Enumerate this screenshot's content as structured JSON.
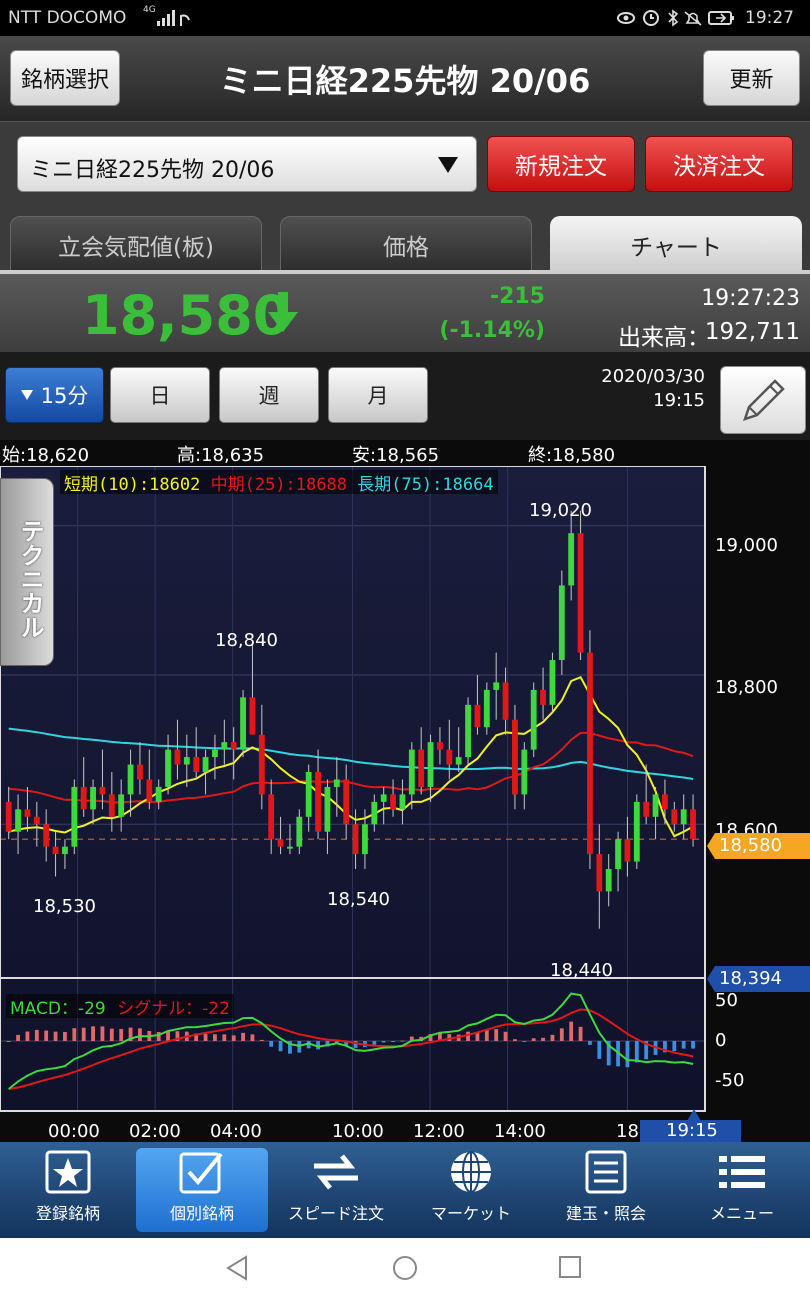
{
  "status": {
    "carrier": "NTT DOCOMO",
    "net": "4G",
    "time": "19:27"
  },
  "header": {
    "left_button": "銘柄選択",
    "title": "ミニ日経225先物 20/06",
    "right_button": "更新"
  },
  "toolbar": {
    "symbol_select": "ミニ日経225先物 20/06",
    "new_order": "新規注文",
    "close_order": "決済注文"
  },
  "tabs": [
    {
      "label": "立会気配値(板)"
    },
    {
      "label": "価格"
    },
    {
      "label": "チャート"
    }
  ],
  "price": {
    "last": "18,580",
    "change": "-215",
    "change_pct": "(-1.14%)",
    "time": "19:27:23",
    "volume_label": "出来高：",
    "volume": "192,711"
  },
  "period": {
    "active": "15分",
    "day": "日",
    "week": "週",
    "month": "月",
    "date": "2020/03/30",
    "time": "19:15"
  },
  "ohlc": {
    "open": "始:18,620",
    "high": "高:18,635",
    "low": "安:18,565",
    "close": "終:18,580"
  },
  "technical_label": "テクニカル",
  "ma": {
    "short": "短期(10):18602",
    "mid": "中期(25):18688",
    "long": "長期(75):18664"
  },
  "price_labels": {
    "l1": "19,020",
    "l2": "18,840",
    "l3": "18,530",
    "l4": "18,540",
    "l5": "18,440"
  },
  "y_ticks": [
    "19,000",
    "18,800",
    "18,600"
  ],
  "current_tag": "18,580",
  "low_tag": "18,394",
  "macd": {
    "macd": "MACD：-29",
    "signal": "シグナル：-22",
    "ticks": [
      "50",
      "0",
      "-50"
    ]
  },
  "x_ticks": [
    "00:00",
    "02:00",
    "04:00",
    "10:00",
    "12:00",
    "14:00",
    "18:"
  ],
  "x_current": "19:15",
  "nav": [
    {
      "label": "登録銘柄"
    },
    {
      "label": "個別銘柄"
    },
    {
      "label": "スピード注文"
    },
    {
      "label": "マーケット"
    },
    {
      "label": "建玉・照会"
    },
    {
      "label": "メニュー"
    }
  ],
  "colors": {
    "up": "#3fd93f",
    "down": "#e01818",
    "short_ma": "#f3f31c",
    "mid_ma": "#e01818",
    "long_ma": "#2fd6e0",
    "accent_orange": "#f5a623",
    "price_green": "#3bbf3b"
  },
  "chart_data": {
    "type": "candlestick",
    "y_range": [
      18394,
      19080
    ],
    "candles": [
      [
        18630,
        18650,
        18580,
        18590
      ],
      [
        18590,
        18640,
        18560,
        18620
      ],
      [
        18620,
        18650,
        18590,
        18610
      ],
      [
        18610,
        18630,
        18570,
        18600
      ],
      [
        18600,
        18620,
        18550,
        18570
      ],
      [
        18570,
        18590,
        18530,
        18560
      ],
      [
        18560,
        18580,
        18540,
        18570
      ],
      [
        18570,
        18660,
        18560,
        18650
      ],
      [
        18650,
        18690,
        18610,
        18620
      ],
      [
        18620,
        18660,
        18600,
        18650
      ],
      [
        18650,
        18700,
        18620,
        18640
      ],
      [
        18640,
        18670,
        18590,
        18610
      ],
      [
        18610,
        18660,
        18590,
        18640
      ],
      [
        18640,
        18700,
        18610,
        18680
      ],
      [
        18680,
        18710,
        18640,
        18660
      ],
      [
        18660,
        18700,
        18620,
        18630
      ],
      [
        18630,
        18660,
        18620,
        18650
      ],
      [
        18650,
        18720,
        18640,
        18700
      ],
      [
        18700,
        18740,
        18660,
        18680
      ],
      [
        18680,
        18720,
        18650,
        18690
      ],
      [
        18690,
        18730,
        18660,
        18670
      ],
      [
        18670,
        18700,
        18640,
        18690
      ],
      [
        18690,
        18720,
        18660,
        18700
      ],
      [
        18700,
        18740,
        18680,
        18710
      ],
      [
        18710,
        18730,
        18660,
        18700
      ],
      [
        18700,
        18780,
        18690,
        18770
      ],
      [
        18770,
        18840,
        18760,
        18720
      ],
      [
        18720,
        18760,
        18620,
        18640
      ],
      [
        18640,
        18660,
        18560,
        18580
      ],
      [
        18580,
        18610,
        18560,
        18570
      ],
      [
        18570,
        18600,
        18560,
        18570
      ],
      [
        18570,
        18620,
        18560,
        18610
      ],
      [
        18610,
        18680,
        18590,
        18670
      ],
      [
        18670,
        18700,
        18580,
        18590
      ],
      [
        18590,
        18660,
        18560,
        18650
      ],
      [
        18650,
        18690,
        18610,
        18660
      ],
      [
        18660,
        18680,
        18580,
        18600
      ],
      [
        18600,
        18620,
        18540,
        18560
      ],
      [
        18560,
        18620,
        18540,
        18600
      ],
      [
        18600,
        18640,
        18590,
        18630
      ],
      [
        18630,
        18650,
        18600,
        18640
      ],
      [
        18640,
        18660,
        18610,
        18620
      ],
      [
        18620,
        18660,
        18600,
        18640
      ],
      [
        18640,
        18710,
        18620,
        18700
      ],
      [
        18700,
        18730,
        18640,
        18650
      ],
      [
        18650,
        18720,
        18630,
        18710
      ],
      [
        18710,
        18730,
        18680,
        18700
      ],
      [
        18700,
        18740,
        18660,
        18680
      ],
      [
        18680,
        18730,
        18670,
        18690
      ],
      [
        18690,
        18770,
        18680,
        18760
      ],
      [
        18760,
        18800,
        18720,
        18730
      ],
      [
        18730,
        18790,
        18720,
        18780
      ],
      [
        18780,
        18830,
        18740,
        18790
      ],
      [
        18790,
        18810,
        18720,
        18740
      ],
      [
        18740,
        18760,
        18620,
        18640
      ],
      [
        18640,
        18710,
        18620,
        18700
      ],
      [
        18700,
        18790,
        18690,
        18780
      ],
      [
        18780,
        18810,
        18740,
        18760
      ],
      [
        18760,
        18830,
        18750,
        18820
      ],
      [
        18820,
        18940,
        18800,
        18920
      ],
      [
        18920,
        19020,
        18900,
        18990
      ],
      [
        18990,
        19020,
        18820,
        18830
      ],
      [
        18830,
        18860,
        18540,
        18560
      ],
      [
        18560,
        18600,
        18460,
        18510
      ],
      [
        18510,
        18560,
        18490,
        18540
      ],
      [
        18540,
        18590,
        18510,
        18580
      ],
      [
        18580,
        18610,
        18530,
        18550
      ],
      [
        18550,
        18640,
        18540,
        18630
      ],
      [
        18630,
        18680,
        18600,
        18610
      ],
      [
        18610,
        18650,
        18580,
        18640
      ],
      [
        18640,
        18660,
        18600,
        18620
      ],
      [
        18620,
        18630,
        18590,
        18600
      ],
      [
        18600,
        18640,
        18580,
        18620
      ],
      [
        18620,
        18640,
        18570,
        18580
      ]
    ]
  }
}
